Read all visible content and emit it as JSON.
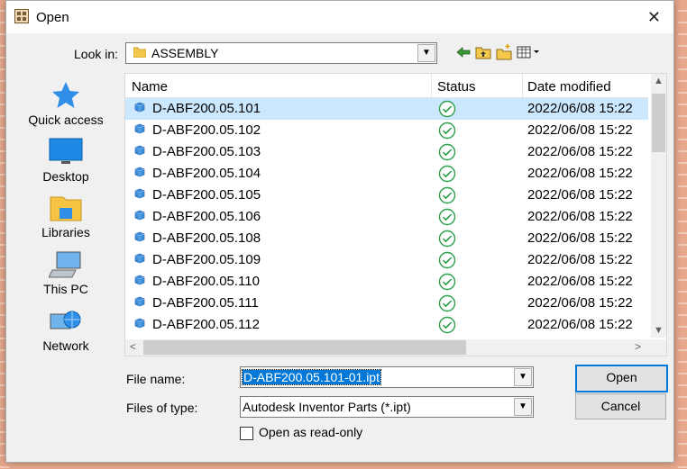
{
  "window": {
    "title": "Open",
    "close_glyph": "✕"
  },
  "look_in": {
    "label": "Look in:",
    "value": "ASSEMBLY"
  },
  "places": [
    {
      "label": "Quick access",
      "icon": "star-icon"
    },
    {
      "label": "Desktop",
      "icon": "desktop-icon"
    },
    {
      "label": "Libraries",
      "icon": "libraries-icon"
    },
    {
      "label": "This PC",
      "icon": "computer-icon"
    },
    {
      "label": "Network",
      "icon": "network-icon"
    }
  ],
  "columns": {
    "name": "Name",
    "status": "Status",
    "date": "Date modified"
  },
  "files": [
    {
      "name": "D-ABF200.05.101",
      "date": "2022/06/08 15:22"
    },
    {
      "name": "D-ABF200.05.102",
      "date": "2022/06/08 15:22"
    },
    {
      "name": "D-ABF200.05.103",
      "date": "2022/06/08 15:22"
    },
    {
      "name": "D-ABF200.05.104",
      "date": "2022/06/08 15:22"
    },
    {
      "name": "D-ABF200.05.105",
      "date": "2022/06/08 15:22"
    },
    {
      "name": "D-ABF200.05.106",
      "date": "2022/06/08 15:22"
    },
    {
      "name": "D-ABF200.05.108",
      "date": "2022/06/08 15:22"
    },
    {
      "name": "D-ABF200.05.109",
      "date": "2022/06/08 15:22"
    },
    {
      "name": "D-ABF200.05.110",
      "date": "2022/06/08 15:22"
    },
    {
      "name": "D-ABF200.05.111",
      "date": "2022/06/08 15:22"
    },
    {
      "name": "D-ABF200.05.112",
      "date": "2022/06/08 15:22"
    }
  ],
  "selected_index": 0,
  "file_name": {
    "label": "File name:",
    "value": "D-ABF200.05.101-01.ipt"
  },
  "file_type": {
    "label": "Files of type:",
    "value": "Autodesk Inventor Parts (*.ipt)"
  },
  "buttons": {
    "open": "Open",
    "cancel": "Cancel"
  },
  "read_only": {
    "label": "Open as read-only",
    "checked": false
  },
  "colors": {
    "selection": "#cce8ff",
    "accent": "#0078d7",
    "status_ok": "#2e9e4a",
    "file_icon": "#3c8fdc"
  }
}
